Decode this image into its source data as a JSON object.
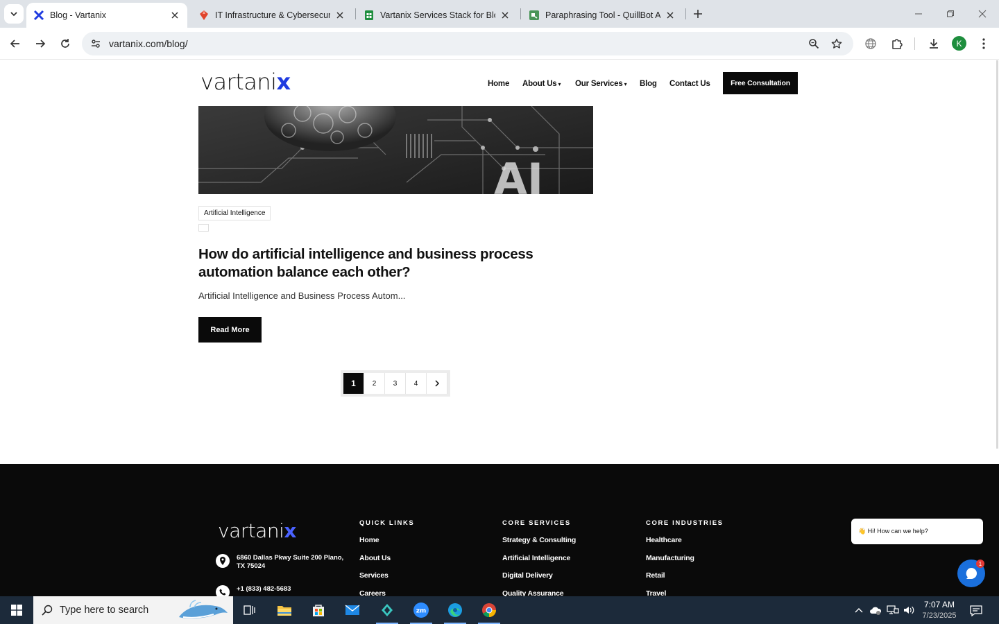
{
  "browser": {
    "tabs": [
      {
        "title": "Blog - Vartanix",
        "active": true,
        "icon": "vartanix-x-icon"
      },
      {
        "title": "IT Infrastructure & Cybersecurit",
        "active": false,
        "icon": "gem-icon"
      },
      {
        "title": "Vartanix Services Stack for Blog",
        "active": false,
        "icon": "sheets-icon"
      },
      {
        "title": "Paraphrasing Tool - QuillBot AI",
        "active": false,
        "icon": "quillbot-icon"
      }
    ],
    "url": "vartanix.com/blog/",
    "profile_initial": "K"
  },
  "site": {
    "logo_main": "vartani",
    "logo_accent": "x",
    "nav": {
      "home": "Home",
      "about": "About Us",
      "services": "Our Services",
      "blog": "Blog",
      "contact": "Contact Us",
      "cta": "Free Consultation"
    }
  },
  "post": {
    "category": "Artificial Intelligence",
    "title": "How do artificial intelligence and business process automation balance each other?",
    "excerpt": "Artificial Intelligence and Business Process Autom...",
    "read_more": "Read More"
  },
  "pagination": {
    "pages": [
      "1",
      "2",
      "3",
      "4"
    ],
    "current": "1"
  },
  "footer": {
    "address": "6860 Dallas Pkwy Suite 200 Plano, TX 75024",
    "phone": "+1 (833) 482-5683",
    "quick_links": {
      "heading": "QUICK LINKS",
      "items": [
        "Home",
        "About Us",
        "Services",
        "Careers"
      ]
    },
    "core_services": {
      "heading": "CORE SERVICES",
      "items": [
        "Strategy & Consulting",
        "Artificial Intelligence",
        "Digital Delivery",
        "Quality Assurance"
      ]
    },
    "core_industries": {
      "heading": "CORE INDUSTRIES",
      "items": [
        "Healthcare",
        "Manufacturing",
        "Retail",
        "Travel"
      ]
    }
  },
  "chat": {
    "greeting": "👋 Hi! How can we help?",
    "badge": "1"
  },
  "taskbar": {
    "search_placeholder": "Type here to search",
    "time": "7:07 AM",
    "date": "7/23/2025"
  },
  "colors": {
    "accent": "#1f3be0",
    "dark": "#0a0a0a",
    "taskbar": "#1c2a3a"
  }
}
